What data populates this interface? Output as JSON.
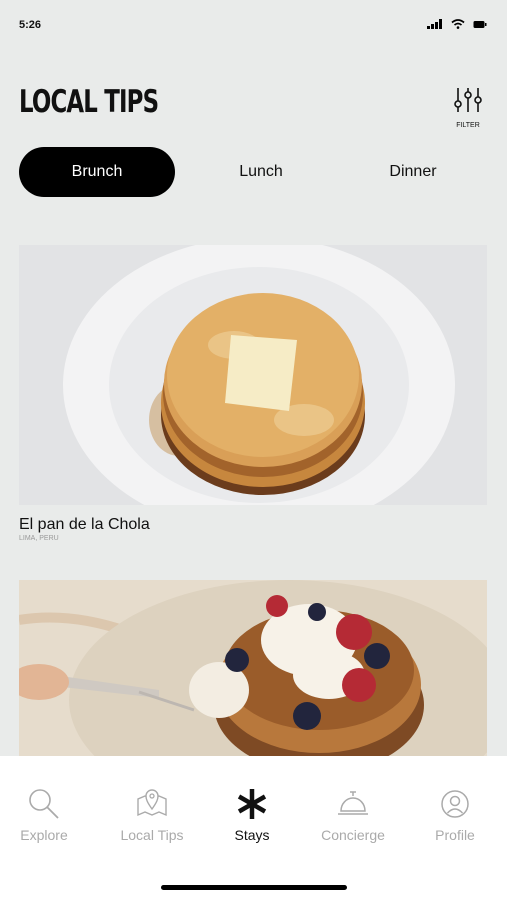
{
  "status": {
    "time": "5:26"
  },
  "header": {
    "title": "LOCAL TIPS",
    "filter_label": "FILTER"
  },
  "tabs": [
    {
      "label": "Brunch",
      "active": true
    },
    {
      "label": "Lunch",
      "active": false
    },
    {
      "label": "Dinner",
      "active": false
    }
  ],
  "cards": [
    {
      "title": "El pan de la Chola",
      "location": "LIMA, PERU",
      "image": "pancakes-with-butter-photo"
    },
    {
      "image": "pancakes-with-berries-photo"
    }
  ],
  "tabbar": [
    {
      "label": "Explore",
      "icon": "search-icon"
    },
    {
      "label": "Local Tips",
      "icon": "map-pin-icon"
    },
    {
      "label": "Stays",
      "icon": "asterisk-icon",
      "active": true
    },
    {
      "label": "Concierge",
      "icon": "service-bell-icon"
    },
    {
      "label": "Profile",
      "icon": "profile-icon"
    }
  ],
  "colors": {
    "accent": "#000000",
    "background": "#e9ebea",
    "inactive": "#aaaaaa"
  }
}
